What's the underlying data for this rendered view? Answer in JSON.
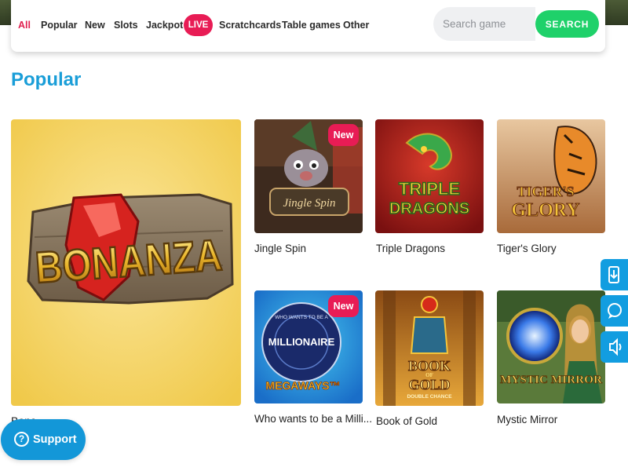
{
  "nav": {
    "tabs": [
      {
        "label": "All",
        "active": true
      },
      {
        "label": "Popular"
      },
      {
        "label": "New"
      },
      {
        "label": "Slots"
      },
      {
        "label": "Jackpot"
      },
      {
        "label": "LIVE"
      },
      {
        "label": "Scratchcards"
      },
      {
        "label": "Table games"
      },
      {
        "label": "Other"
      }
    ],
    "search_placeholder": "Search game",
    "search_button": "SEARCH"
  },
  "section": {
    "title": "Popular"
  },
  "featured": {
    "logo_text": "BONANZA",
    "name": "Bonanza"
  },
  "games": [
    {
      "name": "Jingle Spin",
      "art_text": "Jingle Spin",
      "badge": "New"
    },
    {
      "name": "Triple Dragons",
      "art_line1": "TRIPLE",
      "art_line2": "DRAGONS"
    },
    {
      "name": "Tiger's Glory",
      "art_line1": "TIGER'S",
      "art_line2": "GLORY"
    },
    {
      "name": "Who wants to be a Milli...",
      "art_top": "WHO WANTS TO BE A",
      "art_line1": "MILLIONAIRE",
      "art_line2": "MEGAWAYS™",
      "badge": "New"
    },
    {
      "name": "Book of Gold",
      "art_line1": "BOOK",
      "art_small": "OF",
      "art_line2": "GOLD",
      "art_sub": "DOUBLE CHANCE"
    },
    {
      "name": "Mystic Mirror",
      "art_line1": "MYSTIC MIRROR"
    }
  ],
  "support": {
    "label": "Support",
    "icon": "question-mark-icon"
  },
  "side_widgets": [
    "download-icon",
    "chat-icon",
    "sound-icon"
  ],
  "colors": {
    "accent_blue": "#1a9ed8",
    "live_pink": "#e81c55",
    "search_green": "#1fd16a"
  }
}
